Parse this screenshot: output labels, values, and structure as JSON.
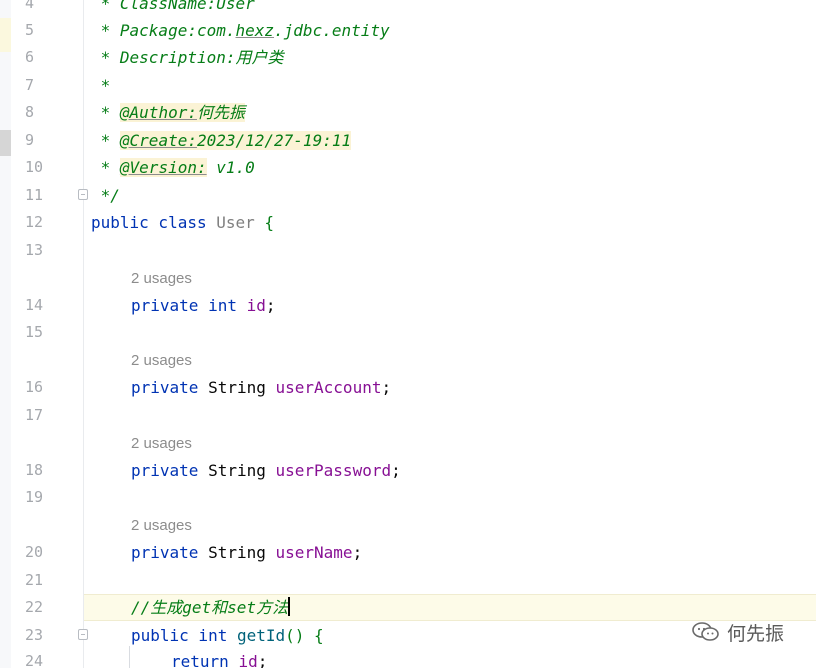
{
  "editor": {
    "line_numbers": [
      "4",
      "5",
      "6",
      "7",
      "8",
      "9",
      "10",
      "11",
      "12",
      "13",
      "14",
      "15",
      "16",
      "17",
      "18",
      "19",
      "20",
      "21",
      "22",
      "23",
      "24"
    ],
    "comment": {
      "line4": " * ClassName:User",
      "line5_prefix": " * Package:com.",
      "line5_ul": "hexz",
      "line5_suffix": ".jdbc.entity",
      "line6": " * Description:用户类",
      "line7": " *",
      "line8_prefix": " * ",
      "line8_tag": "@Author:",
      "line8_val": "何先振",
      "line9_prefix": " * ",
      "line9_tag": "@Create:",
      "line9_val": "2023/12/27-19:11",
      "line10_prefix": " * ",
      "line10_tag": "@Version:",
      "line10_val": " v1.0",
      "line11": " */"
    },
    "class_decl": {
      "kw": "public class ",
      "name": "User",
      "brace": " {"
    },
    "usages": "2 usages",
    "fields": [
      {
        "mods": "private ",
        "type_kw": "int",
        "type_cls": "",
        "name": "id",
        "end": ";"
      },
      {
        "mods": "private ",
        "type_kw": "",
        "type_cls": "String ",
        "name": "userAccount",
        "end": ";"
      },
      {
        "mods": "private ",
        "type_kw": "",
        "type_cls": "String ",
        "name": "userPassword",
        "end": ";"
      },
      {
        "mods": "private ",
        "type_kw": "",
        "type_cls": "String ",
        "name": "userName",
        "end": ";"
      }
    ],
    "line22_comment": "//生成get和set方法",
    "line23": {
      "kw": "public int ",
      "fn": "getId",
      "paren": "()",
      "brace": " {"
    },
    "line24": {
      "kw": "return ",
      "fld": "id",
      "end": ";"
    }
  },
  "watermark": {
    "text": "何先振"
  }
}
